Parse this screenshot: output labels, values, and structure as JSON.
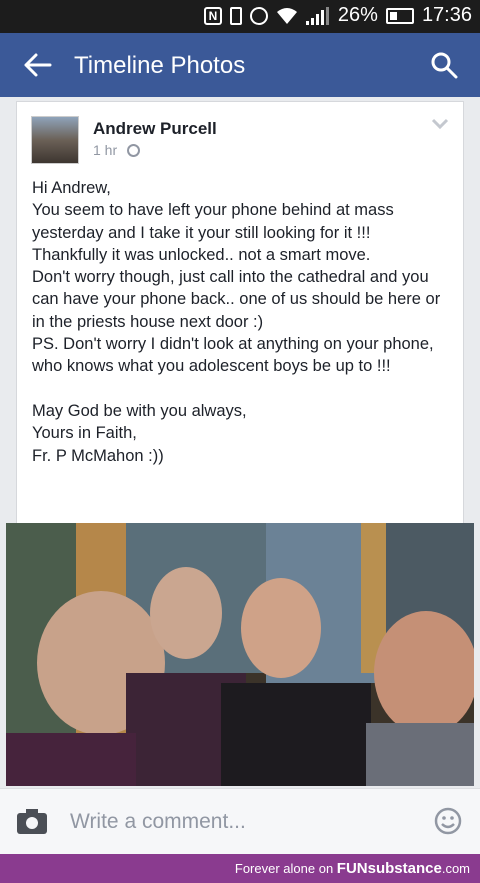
{
  "status_bar": {
    "battery": "26%",
    "time": "17:36",
    "icons": [
      "nfc-icon",
      "vibrate-icon",
      "alarm-icon",
      "wifi-icon",
      "signal-icon",
      "battery-icon"
    ]
  },
  "app_bar": {
    "title": "Timeline Photos",
    "back_icon": "back-arrow-icon",
    "search_icon": "search-icon",
    "color": "#3b5998"
  },
  "post": {
    "author": "Andrew Purcell",
    "time": "1 hr",
    "privacy_icon": "globe-icon",
    "menu_icon": "chevron-down-icon",
    "text": "Hi Andrew,\nYou seem to have left your phone behind at mass yesterday and I take it your still looking for it !!!\nThankfully it was unlocked.. not a smart move.\nDon't worry though, just call into the cathedral and you can have your phone back.. one of us should be here or in the priests house next door :)\nPS. Don't worry I didn't look at anything on your phone, who knows what you adolescent boys be up to !!!\n\nMay God be with you always,\nYours in Faith,\nFr. P McMahon :))"
  },
  "comment_bar": {
    "placeholder": "Write a comment...",
    "camera_icon": "camera-icon",
    "emoji_icon": "smiley-icon"
  },
  "footer": {
    "prefix": "Forever alone on",
    "brand": "FUNsubstance",
    "suffix": ".com",
    "color": "#8a3b8f"
  }
}
